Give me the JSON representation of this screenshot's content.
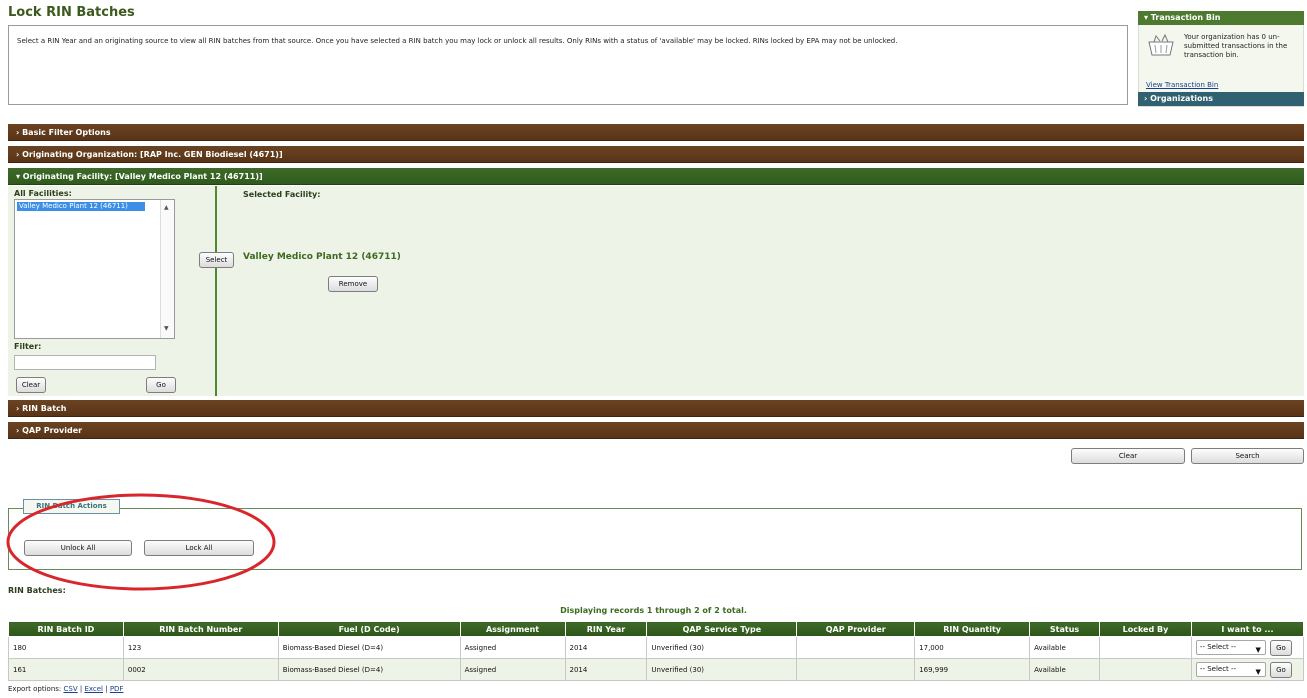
{
  "page": {
    "title": "Lock RIN Batches",
    "description": "Select a RIN Year and an originating source to view all RIN batches from that source. Once you have selected a RIN batch you may lock or unlock all results. Only RINs with a status of 'available' may be locked. RINs locked by EPA may not be unlocked."
  },
  "transaction_bin": {
    "header": "▾ Transaction Bin",
    "message": "Your organization has 0 un-submitted transactions in the transaction bin.",
    "link": "View Transaction Bin",
    "organizations_header": "› Organizations"
  },
  "filters": {
    "basic": "› Basic Filter Options",
    "org": "› Originating Organization: [RAP Inc. GEN Biodiesel (4671)]",
    "facility": "▾ Originating Facility: [Valley Medico Plant 12 (46711)]",
    "rin_batch": "› RIN Batch",
    "qap": "› QAP Provider"
  },
  "facility_panel": {
    "all_label": "All Facilities:",
    "list_option": "Valley Medico Plant 12 (46711)",
    "filter_label": "Filter:",
    "filter_value": "",
    "clear": "Clear",
    "go": "Go",
    "select": "Select",
    "selected_label": "Selected Facility:",
    "selected_name": "Valley Medico Plant 12 (46711)",
    "remove": "Remove"
  },
  "search_buttons": {
    "clear": "Clear",
    "search": "Search"
  },
  "actions": {
    "tab": "RIN Batch Actions",
    "unlock": "Unlock All",
    "lock": "Lock All"
  },
  "results": {
    "label": "RIN Batches:",
    "display": "Displaying records 1 through 2 of 2 total.",
    "headers": [
      "RIN Batch ID",
      "RIN Batch Number",
      "Fuel (D Code)",
      "Assignment",
      "RIN Year",
      "QAP Service Type",
      "QAP Provider",
      "RIN Quantity",
      "Status",
      "Locked By",
      "I want to ..."
    ],
    "rows": [
      {
        "id": "180",
        "number": "123",
        "fuel": "Biomass-Based Diesel (D=4)",
        "assignment": "Assigned",
        "year": "2014",
        "qap_type": "Unverified (30)",
        "qap_provider": "",
        "quantity": "17,000",
        "status": "Available",
        "locked_by": "",
        "select": "-- Select --",
        "go": "Go"
      },
      {
        "id": "161",
        "number": "0002",
        "fuel": "Biomass-Based Diesel (D=4)",
        "assignment": "Assigned",
        "year": "2014",
        "qap_type": "Unverified (30)",
        "qap_provider": "",
        "quantity": "169,999",
        "status": "Available",
        "locked_by": "",
        "select": "-- Select --",
        "go": "Go"
      }
    ]
  },
  "export": {
    "label": "Export options:",
    "csv": "CSV",
    "excel": "Excel",
    "pdf": "PDF"
  },
  "colors": {
    "brown_bar": "#5a3417",
    "green_bar": "#2f5a1c",
    "annotation": "#d8262b"
  }
}
